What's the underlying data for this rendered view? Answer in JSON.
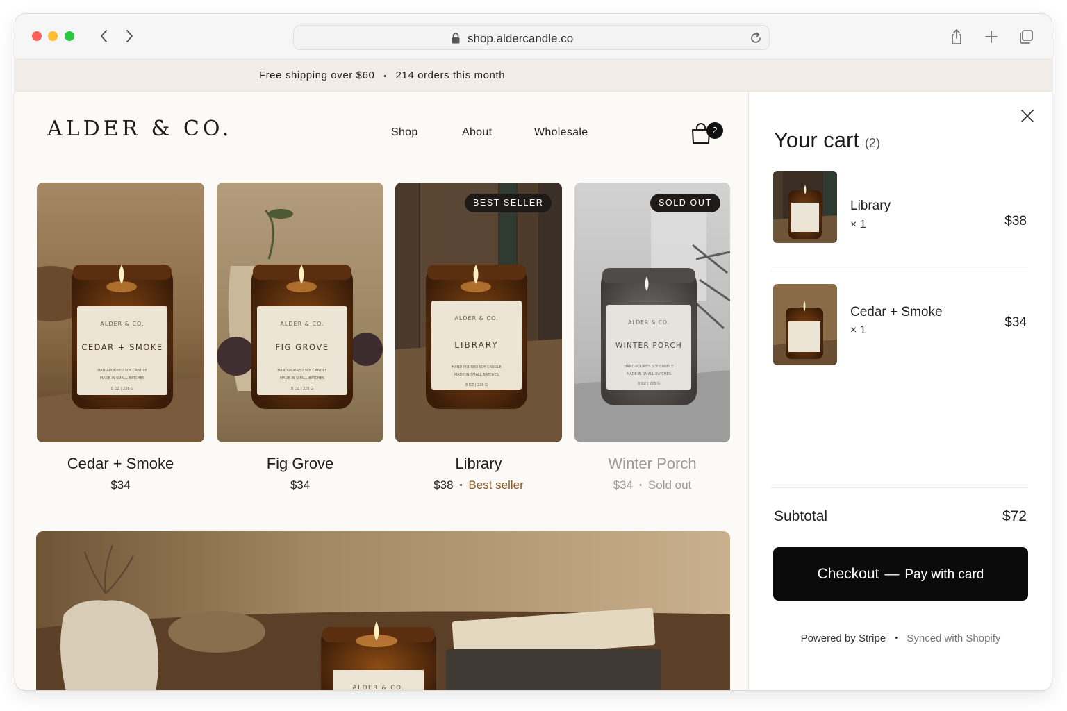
{
  "browser": {
    "url": "shop.aldercandle.co"
  },
  "promo": {
    "shipping": "Free shipping over $60",
    "orders": "214 orders this month",
    "separator": "•"
  },
  "store": {
    "logo": "ALDER & CO.",
    "nav": [
      "Shop",
      "About",
      "Wholesale"
    ],
    "cart_badge": "2"
  },
  "products": [
    {
      "name": "Cedar + Smoke",
      "price": "$34",
      "label": "CEDAR + SMOKE",
      "status": "",
      "badge": ""
    },
    {
      "name": "Fig Grove",
      "price": "$34",
      "label": "FIG GROVE",
      "status": "",
      "badge": ""
    },
    {
      "name": "Library",
      "price": "$38",
      "label": "LIBRARY",
      "status": "Best seller",
      "badge": "BEST SELLER"
    },
    {
      "name": "Winter Porch",
      "price": "$34",
      "label": "WINTER PORCH",
      "status": "Sold out",
      "badge": "SOLD OUT"
    }
  ],
  "jar_label": {
    "brand": "ALDER & CO.",
    "line1": "HAND-POURED SOY CANDLE",
    "line2": "MADE IN SMALL BATCHES",
    "line3": "8 OZ | 226 G"
  },
  "banner": {
    "jar_brand": "ALDER & CO."
  },
  "cart": {
    "title": "Your cart",
    "count": "(2)",
    "items": [
      {
        "name": "Library",
        "qty": "× 1",
        "price": "$38"
      },
      {
        "name": "Cedar + Smoke",
        "qty": "× 1",
        "price": "$34"
      }
    ],
    "subtotal_label": "Subtotal",
    "subtotal": "$72",
    "checkout_main": "Checkout",
    "checkout_dash": "—",
    "checkout_sub": "Pay with card",
    "powered": "Powered by Stripe",
    "synced": "Synced with Shopify",
    "separator": "•"
  },
  "colors": {
    "accent": "#8a5a26",
    "checkout_bg": "#0b0b0b",
    "promo_bg": "#f2ede6"
  }
}
